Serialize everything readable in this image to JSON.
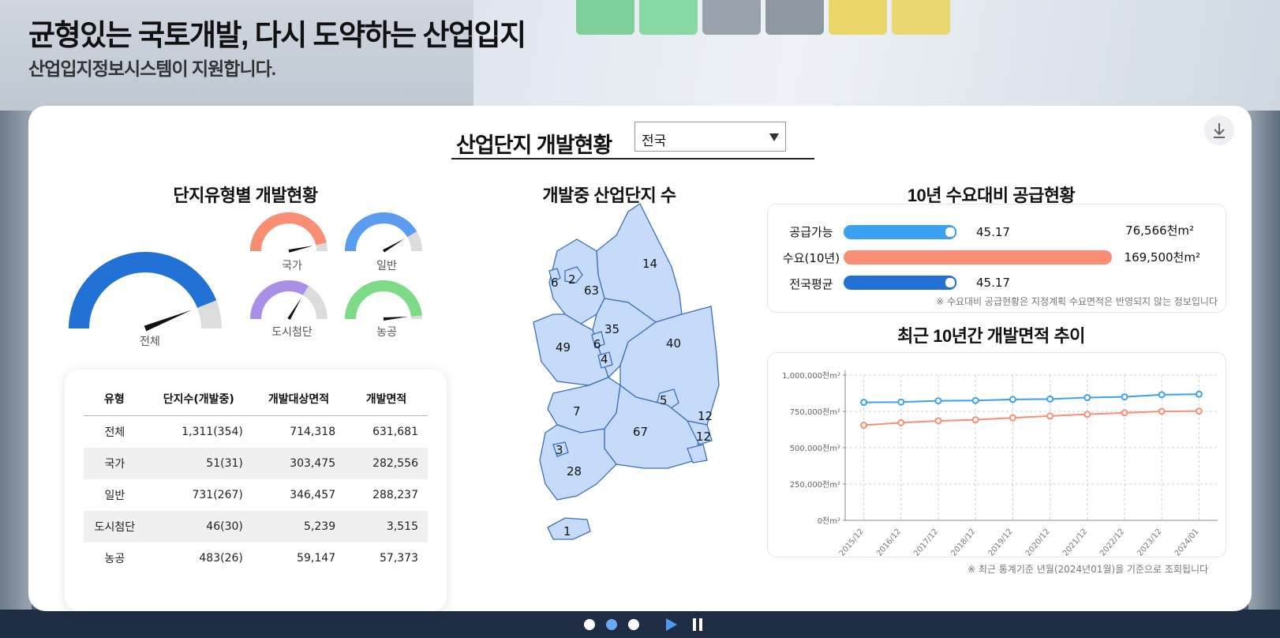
{
  "hero": {
    "title": "균형있는 국토개발, 다시 도약하는 산업입지",
    "subtitle": "산업입지정보시스템이 지원합니다."
  },
  "header": {
    "title": "산업단지 개발현황",
    "region_select": {
      "value": "전국"
    },
    "download_icon": "download-icon"
  },
  "gauges": {
    "title": "단지유형별 개발현황",
    "items": [
      {
        "label": "전체",
        "ratio": 0.88,
        "color": "#2272d6"
      },
      {
        "label": "국가",
        "ratio": 0.93,
        "color": "#f98e74"
      },
      {
        "label": "일반",
        "ratio": 0.83,
        "color": "#5b9cf0"
      },
      {
        "label": "도시첨단",
        "ratio": 0.67,
        "color": "#a98fe6"
      },
      {
        "label": "농공",
        "ratio": 0.97,
        "color": "#7ddb87"
      }
    ]
  },
  "table": {
    "headers": [
      "유형",
      "단지수(개발중)",
      "개발대상면적",
      "개발면적"
    ],
    "rows": [
      [
        "전체",
        "1,311(354)",
        "714,318",
        "631,681"
      ],
      [
        "국가",
        "51(31)",
        "303,475",
        "282,556"
      ],
      [
        "일반",
        "731(267)",
        "346,457",
        "288,237"
      ],
      [
        "도시첨단",
        "46(30)",
        "5,239",
        "3,515"
      ],
      [
        "농공",
        "483(26)",
        "59,147",
        "57,373"
      ]
    ]
  },
  "map": {
    "title": "개발중 산업단지 수",
    "labels": [
      "14",
      "6",
      "2",
      "63",
      "35",
      "6",
      "49",
      "4",
      "40",
      "5",
      "7",
      "67",
      "12",
      "12",
      "3",
      "28",
      "1"
    ]
  },
  "supply": {
    "title": "10년 수요대비 공급현황",
    "rows": [
      {
        "label": "공급가능",
        "value": "45.17",
        "area": "76,566천m²",
        "ratio": 0.42,
        "color": "#3aa2f0",
        "knob": true
      },
      {
        "label": "수요(10년)",
        "value": "",
        "area": "169,500천m²",
        "ratio": 1.0,
        "color": "#f98e74",
        "knob": false
      },
      {
        "label": "전국평균",
        "value": "45.17",
        "area": "",
        "ratio": 0.42,
        "color": "#2272d6",
        "knob": true
      }
    ],
    "note": "※ 수요대비 공급현황은 지정계획 수요면적은 반영되지 않는 정보입니다"
  },
  "trend": {
    "title": "최근 10년간 개발면적 추이",
    "footnote": "※ 최근 통계기준 년월(2024년01월)을 기준으로 조회됩니다"
  },
  "chart_data": {
    "type": "line",
    "title": "최근 10년간 개발면적 추이",
    "x": [
      "2015/12",
      "2016/12",
      "2017/12",
      "2018/12",
      "2019/12",
      "2020/12",
      "2021/12",
      "2022/12",
      "2023/12",
      "2024/01"
    ],
    "series": [
      {
        "values": [
          812000,
          814000,
          823000,
          825000,
          832000,
          835000,
          845000,
          850000,
          865000,
          868000
        ],
        "color": "#3aa2f0"
      },
      {
        "values": [
          655000,
          672000,
          685000,
          692000,
          706000,
          718000,
          730000,
          740000,
          750000,
          752000
        ],
        "color": "#f98e74"
      }
    ],
    "yticks": [
      "0천m²",
      "250,000천m²",
      "500,000천m²",
      "750,000천m²",
      "1,000,000천m²"
    ],
    "ylim": [
      0,
      1000000
    ],
    "grid": true
  },
  "pager": {
    "dots": 3,
    "active": 1
  }
}
